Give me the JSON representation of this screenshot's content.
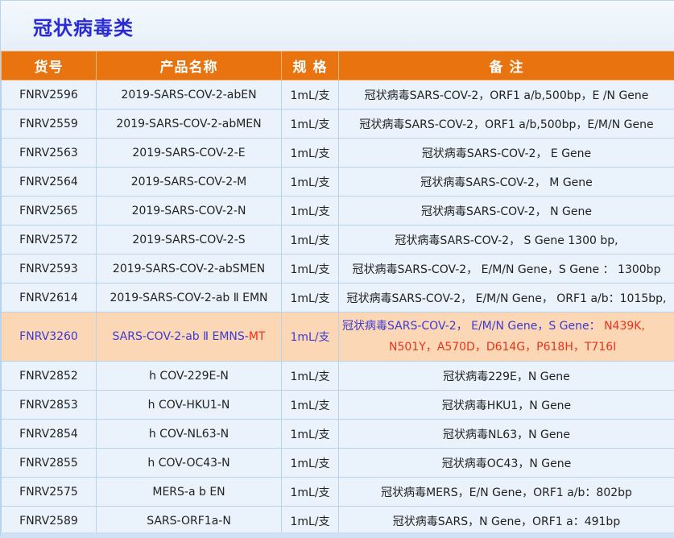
{
  "title": "冠状病毒类",
  "headers": [
    "货号",
    "产品名称",
    "规 格",
    "备 注"
  ],
  "rows": [
    {
      "id": "FNRV2596",
      "name": "2019-SARS-COV-2-abEN",
      "spec": "1mL/支",
      "note": "冠状病毒SARS-COV-2，ORF1 a/b,500bp，E /N Gene"
    },
    {
      "id": "FNRV2559",
      "name": "2019-SARS-COV-2-abMEN",
      "spec": "1mL/支",
      "note": "冠状病毒SARS-COV-2，ORF1 a/b,500bp，E/M/N Gene"
    },
    {
      "id": "FNRV2563",
      "name": "2019-SARS-COV-2-E",
      "spec": "1mL/支",
      "note": "冠状病毒SARS-COV-2， E Gene"
    },
    {
      "id": "FNRV2564",
      "name": "2019-SARS-COV-2-M",
      "spec": "1mL/支",
      "note": "冠状病毒SARS-COV-2， M Gene"
    },
    {
      "id": "FNRV2565",
      "name": "2019-SARS-COV-2-N",
      "spec": "1mL/支",
      "note": "冠状病毒SARS-COV-2， N Gene"
    },
    {
      "id": "FNRV2572",
      "name": "2019-SARS-COV-2-S",
      "spec": "1mL/支",
      "note": "冠状病毒SARS-COV-2， S Gene 1300 bp,"
    },
    {
      "id": "FNRV2593",
      "name": "2019-SARS-COV-2-abSMEN",
      "spec": "1mL/支",
      "note": "冠状病毒SARS-COV-2， E/M/N Gene，S Gene ： 1300bp"
    },
    {
      "id": "FNRV2614",
      "name": "2019-SARS-COV-2-ab Ⅱ EMN",
      "spec": "1mL/支",
      "note": "冠状病毒SARS-COV-2， E/M/N Gene， ORF1 a/b：1015bp,"
    }
  ],
  "highlight_row": {
    "id": "FNRV3260",
    "name_main": "SARS-COV-2-ab Ⅱ EMNS-",
    "name_red": "MT",
    "spec": "1mL/支",
    "note_main": "冠状病毒SARS-COV-2， E/M/N Gene，S Gene：",
    "note_red1": "N439K,",
    "note_red2": "N501Y，A570D，D614G，P618H，T716I"
  },
  "rows2": [
    {
      "id": "FNRV2852",
      "name": "h COV-229E-N",
      "spec": "1mL/支",
      "note": "冠状病毒229E，N Gene"
    },
    {
      "id": "FNRV2853",
      "name": "h COV-HKU1-N",
      "spec": "1mL/支",
      "note": "冠状病毒HKU1，N Gene"
    },
    {
      "id": "FNRV2854",
      "name": "h COV-NL63-N",
      "spec": "1mL/支",
      "note": "冠状病毒NL63，N Gene"
    },
    {
      "id": "FNRV2855",
      "name": "h COV-OC43-N",
      "spec": "1mL/支",
      "note": "冠状病毒OC43，N Gene"
    },
    {
      "id": "FNRV2575",
      "name": "MERS-a b EN",
      "spec": "1mL/支",
      "note": "冠状病毒MERS，E/N Gene，ORF1 a/b：802bp"
    },
    {
      "id": "FNRV2589",
      "name": "SARS-ORF1a-N",
      "spec": "1mL/支",
      "note": "冠状病毒SARS，N Gene，ORF1 a：491bp"
    }
  ],
  "colors": {
    "header_bg": "#e8730f",
    "title": "#2b2bd6",
    "highlight_bg": "#fcd7b5",
    "highlight_text": "#3b3bd3",
    "red": "#e8331c"
  }
}
